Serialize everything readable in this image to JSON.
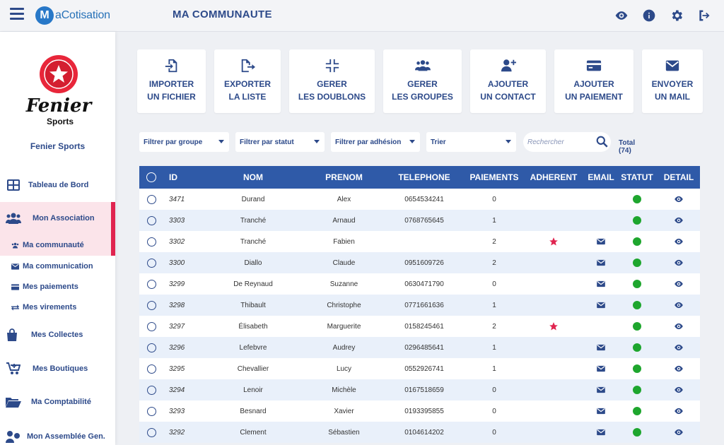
{
  "app": {
    "logo_letter": "M",
    "logo_text": "aCotisation",
    "page_title": "MA COMMUNAUTE"
  },
  "club": {
    "logo_top": "Fenier",
    "logo_bottom": "Sports",
    "name": "Fenier Sports"
  },
  "nav": {
    "dashboard": "Tableau de Bord",
    "association": "Mon Association",
    "sub": {
      "communaute": "Ma communauté",
      "communication": "Ma communication",
      "paiements": "Mes paiements",
      "virements": "Mes virements"
    },
    "collectes": "Mes Collectes",
    "boutiques": "Mes Boutiques",
    "comptabilite": "Ma Comptabilité",
    "assemblee": "Mon Assemblée Gen."
  },
  "actions": [
    {
      "line1": "IMPORTER",
      "line2": "UN FICHIER"
    },
    {
      "line1": "EXPORTER",
      "line2": "LA LISTE"
    },
    {
      "line1": "GERER",
      "line2": "LES DOUBLONS"
    },
    {
      "line1": "GERER",
      "line2": "LES GROUPES"
    },
    {
      "line1": "AJOUTER",
      "line2": "UN CONTACT"
    },
    {
      "line1": "AJOUTER",
      "line2": "UN PAIEMENT"
    },
    {
      "line1": "ENVOYER",
      "line2": "UN MAIL"
    }
  ],
  "filters": {
    "groupe": "Filtrer par groupe",
    "statut": "Filtrer par statut",
    "adhesion": "Filtrer par adhésion",
    "trier": "Trier",
    "search_placeholder": "Rechercher",
    "total": "Total (74)"
  },
  "table": {
    "headers": {
      "id": "ID",
      "nom": "NOM",
      "prenom": "PRENOM",
      "telephone": "TELEPHONE",
      "paiements": "PAIEMENTS",
      "adherent": "ADHERENT",
      "email": "EMAIL",
      "statut": "STATUT",
      "detail": "DETAIL"
    },
    "rows": [
      {
        "id": "3471",
        "nom": "Durand",
        "prenom": "Alex",
        "tel": "0654534241",
        "paiements": "0",
        "adherent": false,
        "email": false
      },
      {
        "id": "3303",
        "nom": "Tranché",
        "prenom": "Arnaud",
        "tel": "0768765645",
        "paiements": "1",
        "adherent": false,
        "email": false
      },
      {
        "id": "3302",
        "nom": "Tranché",
        "prenom": "Fabien",
        "tel": "",
        "paiements": "2",
        "adherent": true,
        "email": true
      },
      {
        "id": "3300",
        "nom": "Diallo",
        "prenom": "Claude",
        "tel": "0951609726",
        "paiements": "2",
        "adherent": false,
        "email": true
      },
      {
        "id": "3299",
        "nom": "De Reynaud",
        "prenom": "Suzanne",
        "tel": "0630471790",
        "paiements": "0",
        "adherent": false,
        "email": true
      },
      {
        "id": "3298",
        "nom": "Thibault",
        "prenom": "Christophe",
        "tel": "0771661636",
        "paiements": "1",
        "adherent": false,
        "email": true
      },
      {
        "id": "3297",
        "nom": "Élisabeth",
        "prenom": "Marguerite",
        "tel": "0158245461",
        "paiements": "2",
        "adherent": true,
        "email": false
      },
      {
        "id": "3296",
        "nom": "Lefebvre",
        "prenom": "Audrey",
        "tel": "0296485641",
        "paiements": "1",
        "adherent": false,
        "email": true
      },
      {
        "id": "3295",
        "nom": "Chevallier",
        "prenom": "Lucy",
        "tel": "0552926741",
        "paiements": "1",
        "adherent": false,
        "email": true
      },
      {
        "id": "3294",
        "nom": "Lenoir",
        "prenom": "Michèle",
        "tel": "0167518659",
        "paiements": "0",
        "adherent": false,
        "email": true
      },
      {
        "id": "3293",
        "nom": "Besnard",
        "prenom": "Xavier",
        "tel": "0193395855",
        "paiements": "0",
        "adherent": false,
        "email": true
      },
      {
        "id": "3292",
        "nom": "Clement",
        "prenom": "Sébastien",
        "tel": "0104614202",
        "paiements": "0",
        "adherent": false,
        "email": true
      }
    ]
  },
  "colors": {
    "primary": "#2d4a8a",
    "header": "#2f5aa8",
    "accent": "#e0244f",
    "status": "#1ea62e"
  }
}
